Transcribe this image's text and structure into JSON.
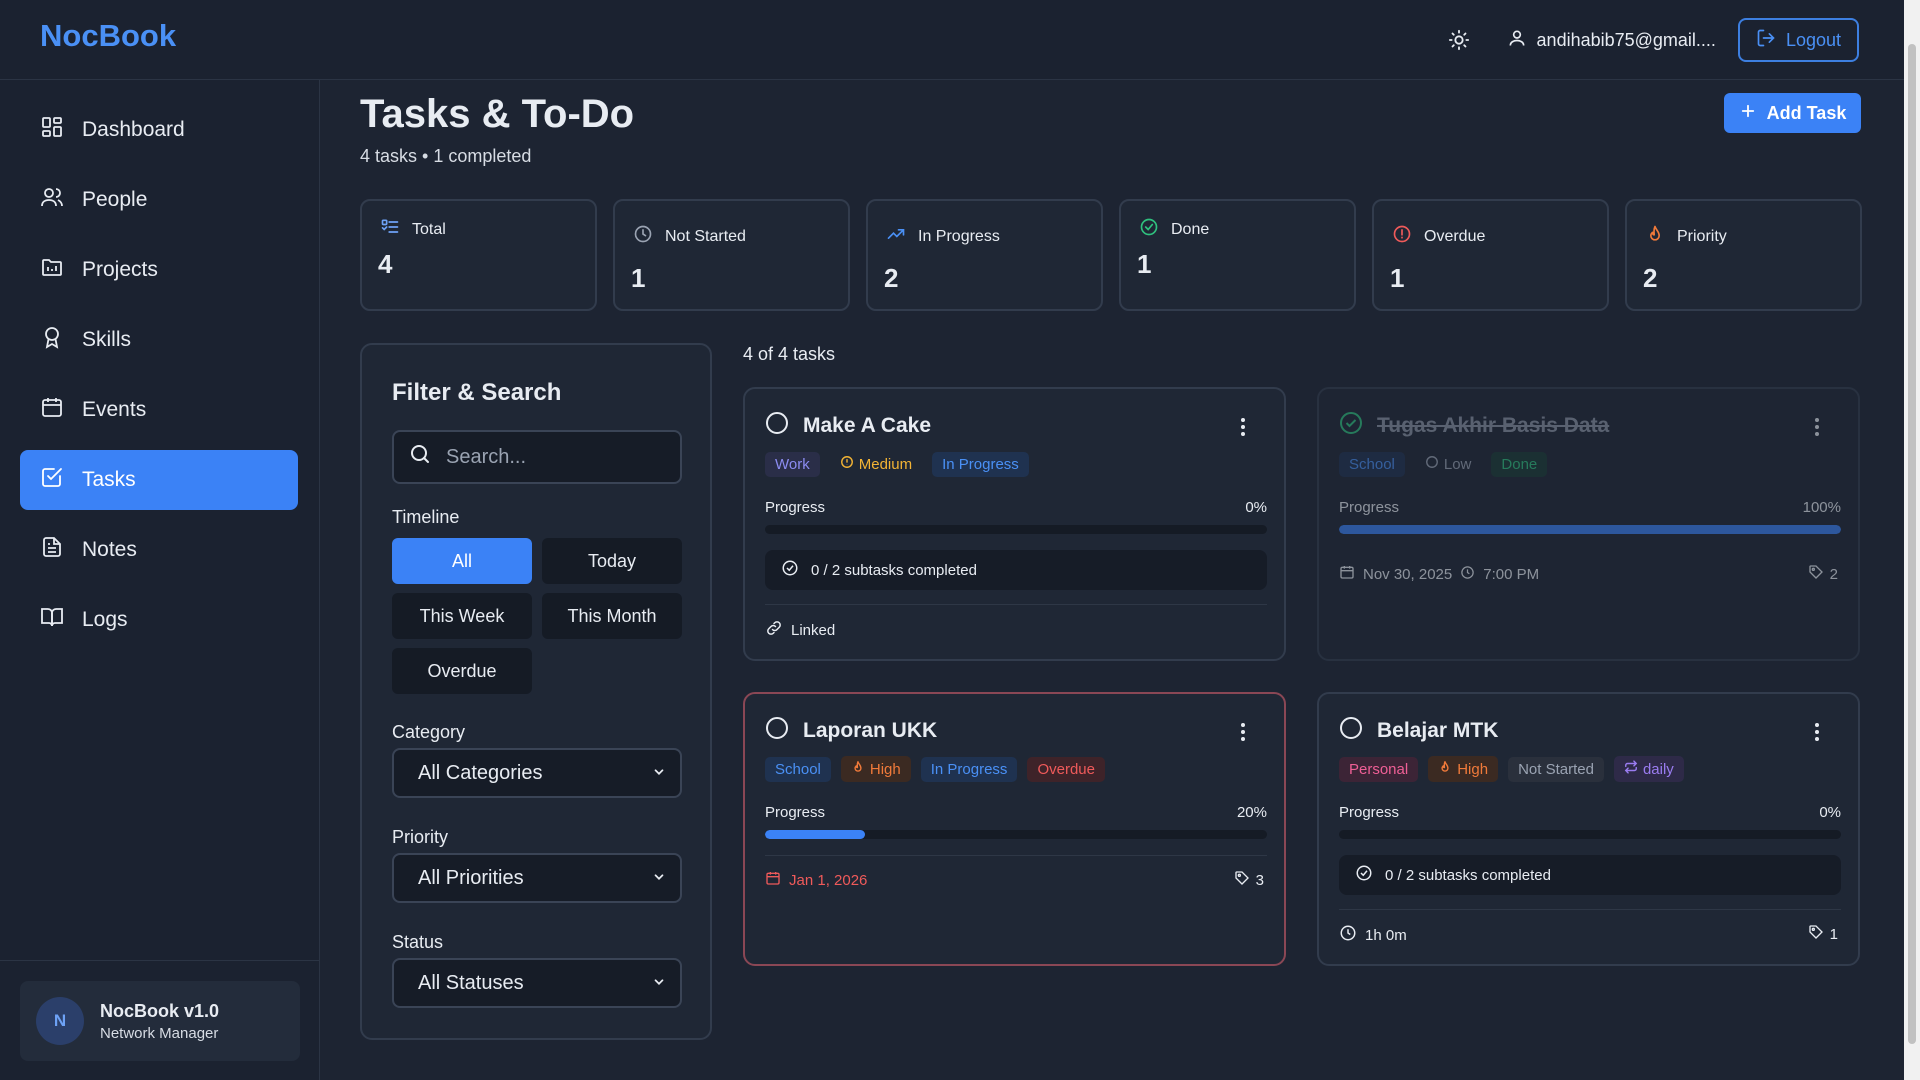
{
  "header": {
    "brand": "NocBook",
    "user_email": "andihabib75@gmail....",
    "logout_label": "Logout",
    "theme_icon": "sun-icon"
  },
  "sidebar": {
    "items": [
      {
        "label": "Dashboard",
        "icon": "dashboard-icon"
      },
      {
        "label": "People",
        "icon": "people-icon"
      },
      {
        "label": "Projects",
        "icon": "projects-icon"
      },
      {
        "label": "Skills",
        "icon": "award-icon"
      },
      {
        "label": "Events",
        "icon": "calendar-icon"
      },
      {
        "label": "Tasks",
        "icon": "checkbox-icon",
        "active": true
      },
      {
        "label": "Notes",
        "icon": "document-icon"
      },
      {
        "label": "Logs",
        "icon": "book-icon"
      }
    ],
    "footer": {
      "avatar": "N",
      "title": "NocBook v1.0",
      "subtitle": "Network Manager"
    }
  },
  "page": {
    "title": "Tasks & To-Do",
    "subtitle": "4 tasks • 1 completed",
    "add_task_label": "Add Task"
  },
  "stats": [
    {
      "label": "Total",
      "value": "4",
      "icon": "list-icon",
      "color": "#6ea2f6"
    },
    {
      "label": "Not Started",
      "value": "1",
      "icon": "clock-icon",
      "color": "#9aa3b2"
    },
    {
      "label": "In Progress",
      "value": "2",
      "icon": "trending-up-icon",
      "color": "#4a90f5"
    },
    {
      "label": "Done",
      "value": "1",
      "icon": "check-circle-icon",
      "color": "#2fc17e"
    },
    {
      "label": "Overdue",
      "value": "1",
      "icon": "alert-circle-icon",
      "color": "#ef5a5a"
    },
    {
      "label": "Priority",
      "value": "2",
      "icon": "flame-icon",
      "color": "#f07a3a"
    }
  ],
  "filter": {
    "title": "Filter & Search",
    "search_placeholder": "Search...",
    "timeline_label": "Timeline",
    "timeline_options": [
      "All",
      "Today",
      "This Week",
      "This Month",
      "Overdue"
    ],
    "timeline_selected": "All",
    "category_label": "Category",
    "category_value": "All Categories",
    "priority_label": "Priority",
    "priority_value": "All Priorities",
    "status_label": "Status",
    "status_value": "All Statuses"
  },
  "task_count": "4 of 4 tasks",
  "tasks": [
    {
      "title": "Make A Cake",
      "tags": [
        "Work",
        "Medium",
        "In Progress"
      ],
      "progress_label": "Progress",
      "progress_text": "0%",
      "progress": 0,
      "subtasks": "0 / 2 subtasks completed",
      "footer": "Linked"
    },
    {
      "title": "Tugas Akhir Basis Data",
      "tags": [
        "School",
        "Low",
        "Done"
      ],
      "progress_label": "Progress",
      "progress_text": "100%",
      "progress": 1,
      "date": "Nov 30, 2025",
      "time": "7:00 PM",
      "tag_count": "2"
    },
    {
      "title": "Laporan UKK",
      "tags": [
        "School",
        "High",
        "In Progress",
        "Overdue"
      ],
      "progress_label": "Progress",
      "progress_text": "20%",
      "progress": 0.2,
      "date": "Jan 1, 2026",
      "tag_count": "3"
    },
    {
      "title": "Belajar MTK",
      "tags": [
        "Personal",
        "High",
        "Not Started",
        "daily"
      ],
      "progress_label": "Progress",
      "progress_text": "0%",
      "progress": 0,
      "subtasks": "0 / 2 subtasks completed",
      "duration": "1h 0m",
      "tag_count": "1"
    }
  ]
}
